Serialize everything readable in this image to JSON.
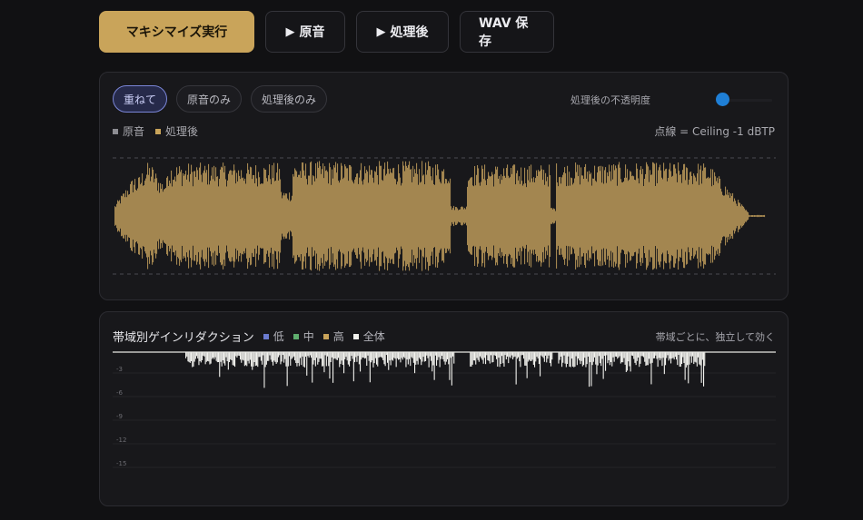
{
  "toolbar": {
    "maximize_label": "マキシマイズ実行",
    "original_label": "原音",
    "processed_label": "処理後",
    "save_label": "WAV 保存"
  },
  "waveform_panel": {
    "view_tabs": [
      {
        "label": "重ねて",
        "active": true
      },
      {
        "label": "原音のみ",
        "active": false
      },
      {
        "label": "処理後のみ",
        "active": false
      }
    ],
    "opacity_label": "処理後の不透明度",
    "opacity_value": 0.0,
    "legend": [
      {
        "label": "原音",
        "color": "#8d8d92"
      },
      {
        "label": "処理後",
        "color": "#c9a45a"
      }
    ],
    "ceiling_note": "点線 = Ceiling -1 dBTP"
  },
  "gain_reduction_panel": {
    "title": "帯域別ゲインリダクション",
    "legend": [
      {
        "label": "低",
        "color": "#6b7bd0"
      },
      {
        "label": "中",
        "color": "#5fae6e"
      },
      {
        "label": "高",
        "color": "#c9a45a"
      },
      {
        "label": "全体",
        "color": "#f2f2ee"
      }
    ],
    "note": "帯域ごとに、独立して効く",
    "y_ticks": [
      "-3",
      "-6",
      "-9",
      "-12",
      "-15"
    ]
  },
  "colors": {
    "accent": "#c9a45a",
    "wave": "#a38650",
    "slider": "#1f7fd6",
    "gr_line": "#f2f2ee"
  }
}
